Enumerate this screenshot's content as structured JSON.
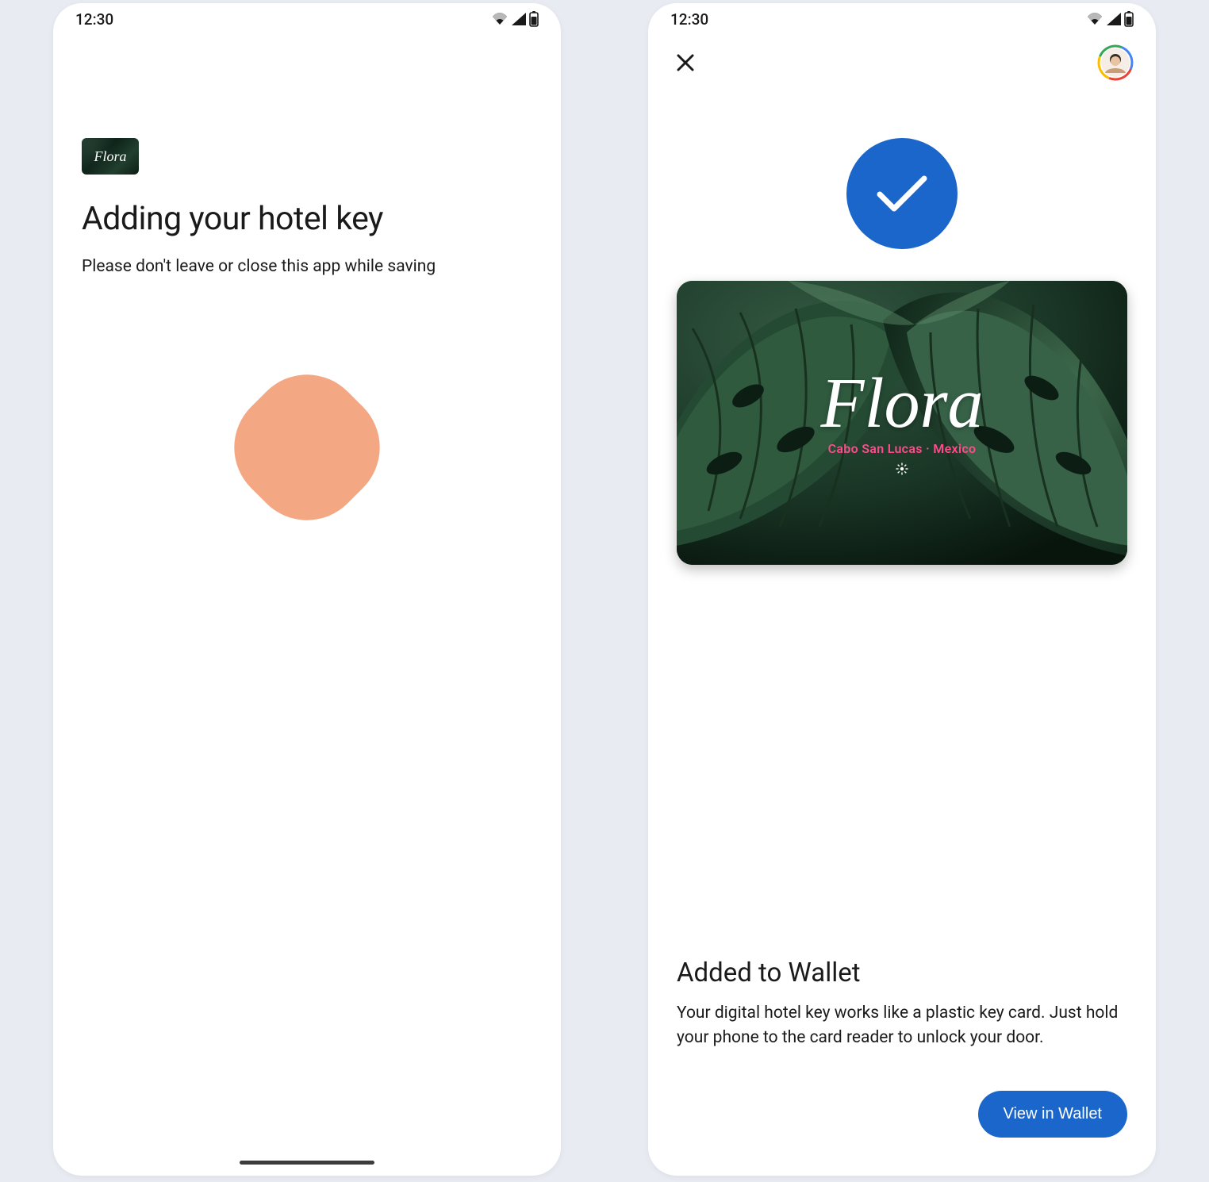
{
  "status_bar": {
    "time": "12:30"
  },
  "screen1": {
    "card_brand": "Flora",
    "heading": "Adding your hotel key",
    "subheading": "Please don't leave or close this app while saving"
  },
  "screen2": {
    "card_brand": "Flora",
    "card_location": "Cabo San Lucas · Mexico",
    "heading": "Added to Wallet",
    "description": "Your digital hotel key works like a plastic key card. Just hold your phone to the card reader to unlock your door.",
    "button_label": "View in Wallet"
  }
}
